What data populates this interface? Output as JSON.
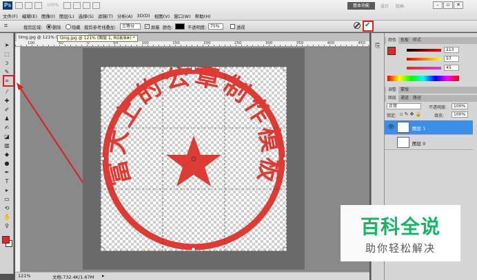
{
  "app": {
    "logo": "Ps",
    "zoom_display": "100%",
    "workspace_active": "基本功能",
    "workspace_items": [
      "设计",
      "绘画"
    ]
  },
  "menu": [
    "文件(F)",
    "编辑(E)",
    "图像(I)",
    "图层(L)",
    "选择(S)",
    "滤镜(T)",
    "分析(A)",
    "3D(D)",
    "视图(V)",
    "窗口(W)",
    "帮助(H)"
  ],
  "options": {
    "crop_area_label": "裁剪区域:",
    "delete_label": "删除",
    "hide_label": "隐藏",
    "guide_label": "裁剪参考线叠加:",
    "guide_value": "三等分",
    "shield_label": "屏蔽",
    "color_label": "颜色:",
    "opacity_label": "不透明度:",
    "opacity_value": "75%",
    "perspective_label": "透视",
    "commit_icon": "checkmark-icon",
    "cancel_icon": "cancel-icon",
    "highlight_color": "#e02020"
  },
  "document": {
    "tab_label": "timg.jpg @ 121% (图层 1, RGB/8#) *",
    "tooltip": "timg.jpg @ 121% (图层 1, RGB/8#) *",
    "seal_text": "富大上的公章制作模板",
    "seal_color": "#dd3b34",
    "ruler_numbers": [
      "100",
      "50",
      "0",
      "50",
      "100",
      "150",
      "200",
      "250",
      "300",
      "350",
      "400",
      "450"
    ]
  },
  "status": {
    "zoom": "121%",
    "doc_size": "文档:732.4K/1.67M"
  },
  "color_panel": {
    "tabs": [
      "颜色",
      "色板",
      "样式"
    ],
    "swatch": "#d62c2c",
    "r": "213",
    "g": "57",
    "b": "45"
  },
  "adjust_panel": {
    "tabs": [
      "调整",
      "蒙版"
    ]
  },
  "layers_panel": {
    "tabs": [
      "图层",
      "通道",
      "路径"
    ],
    "blend_mode": "正常",
    "opacity_label": "不透明度:",
    "opacity_value": "100%",
    "lock_label": "锁定:",
    "fill_label": "填充:",
    "fill_value": "100%",
    "layers": [
      {
        "name": "图层 1",
        "selected": true
      },
      {
        "name": "图层 0",
        "selected": false
      }
    ]
  },
  "watermark": {
    "title": "百科全说",
    "subtitle": "助你轻松解决"
  }
}
